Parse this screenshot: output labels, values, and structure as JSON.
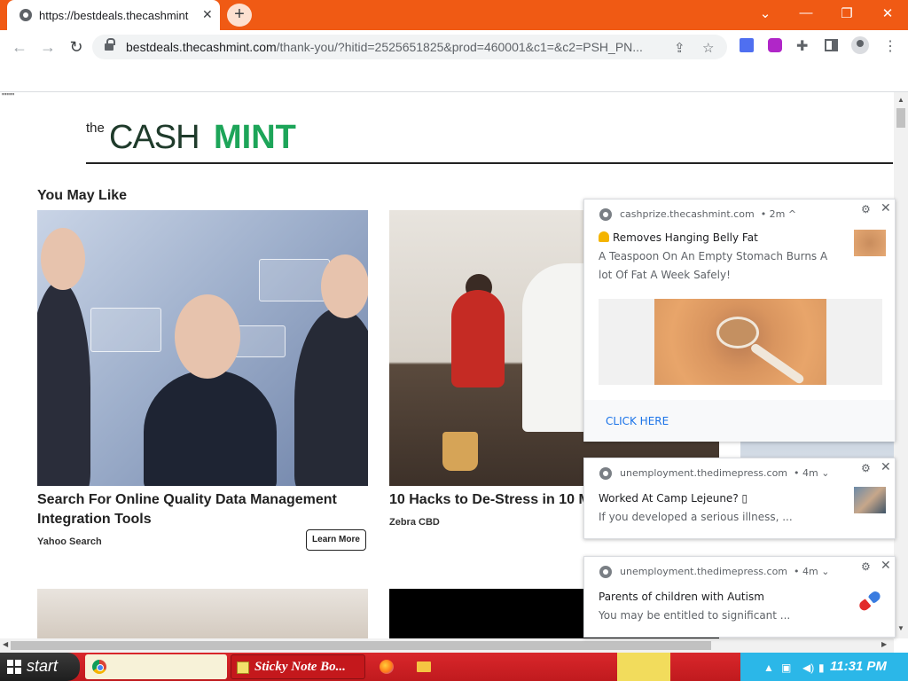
{
  "browser": {
    "tab_title": "https://bestdeals.thecashmint",
    "tab_close": "✕",
    "new_tab": "+",
    "url_host": "bestdeals.thecashmint.com",
    "url_path": "/thank-you/?hitid=2525651825&prod=460001&c1=&c2=PSH_PN...",
    "window_controls": {
      "tabs_dropdown": "⌄",
      "minimize": "—",
      "restore": "❐",
      "close": "✕"
    },
    "icons": [
      "back-icon",
      "forward-icon",
      "reload-icon",
      "lock-icon",
      "share-icon",
      "star-icon",
      "extension-icon",
      "side-panel-icon",
      "profile-icon",
      "menu-icon"
    ]
  },
  "page": {
    "stray_text": "\"\"\"\"",
    "logo": {
      "the": "the",
      "cash": "CASH",
      "mint": "MINT"
    },
    "section_title": "You May Like",
    "cards": [
      {
        "title": "Search For Online Quality Data Management Integration Tools",
        "source": "Yahoo Search",
        "button": "Learn More"
      },
      {
        "title": "10 Hacks to De-Stress in 10 M",
        "source": "Zebra CBD"
      }
    ]
  },
  "notifications": [
    {
      "site": "cashprize.thecashmint.com",
      "age": "• 2m ^",
      "title": "Removes Hanging Belly Fat",
      "body": "A Teaspoon On An Empty Stomach Burns A lot Of Fat A Week Safely!",
      "action": "CLICK HERE"
    },
    {
      "site": "unemployment.thedimepress.com",
      "age": "• 4m ⌄",
      "title": "Worked At Camp Lejeune? ▯",
      "body": "If you developed a serious illness, ..."
    },
    {
      "site": "unemployment.thedimepress.com",
      "age": "• 4m ⌄",
      "title": "Parents of children with Autism",
      "body": "You may be entitled to significant ..."
    }
  ],
  "taskbar": {
    "start": "start",
    "sticky_note": "Sticky Note Bo...",
    "clock": "11:31 PM"
  },
  "colors": {
    "tabstrip": "#f05a14",
    "logo_cash": "#1f3b2b",
    "logo_mint": "#1da559",
    "taskbar": "#c01a1e",
    "link_blue": "#1a73e8"
  }
}
